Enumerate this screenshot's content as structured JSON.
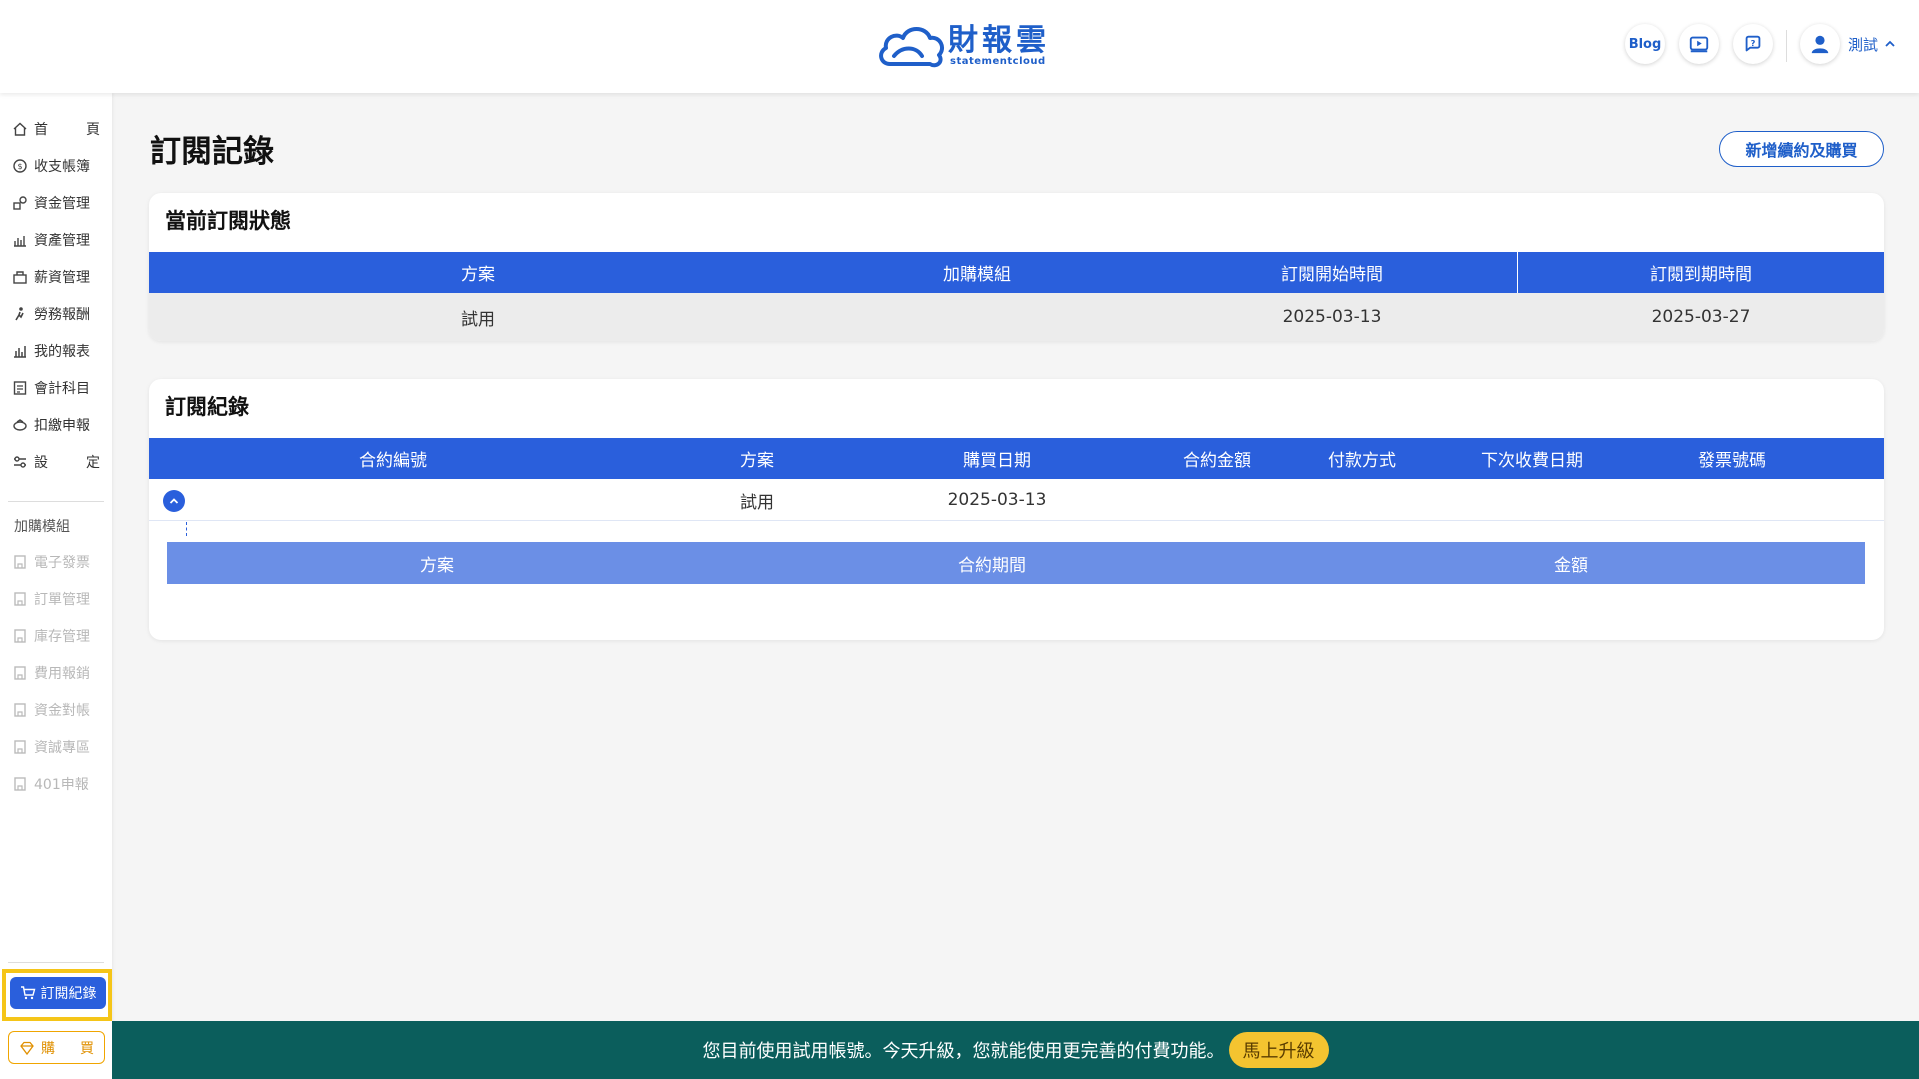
{
  "header": {
    "logo_text": "財報雲",
    "logo_sub": "statementcloud",
    "blog_label": "Blog",
    "user_name": "測試",
    "user_chevron": "^"
  },
  "sidebar": {
    "main_items": [
      {
        "label_a": "首",
        "label_b": "頁",
        "icon": "home-icon"
      },
      {
        "label": "收支帳簿",
        "icon": "ledger-icon"
      },
      {
        "label": "資金管理",
        "icon": "fund-icon"
      },
      {
        "label": "資產管理",
        "icon": "asset-icon"
      },
      {
        "label": "薪資管理",
        "icon": "salary-icon"
      },
      {
        "label": "勞務報酬",
        "icon": "labor-icon"
      },
      {
        "label": "我的報表",
        "icon": "report-icon"
      },
      {
        "label": "會計科目",
        "icon": "account-icon"
      },
      {
        "label": "扣繳申報",
        "icon": "withholding-icon"
      },
      {
        "label_a": "設",
        "label_b": "定",
        "icon": "settings-icon"
      }
    ],
    "addon_heading": "加購模組",
    "addon_items": [
      {
        "label": "電子發票"
      },
      {
        "label": "訂單管理"
      },
      {
        "label": "庫存管理"
      },
      {
        "label": "費用報銷"
      },
      {
        "label": "資金對帳"
      },
      {
        "label": "資誠專區"
      },
      {
        "label": "401申報"
      }
    ],
    "subscription_label": "訂閱紀錄",
    "buy_label_a": "購",
    "buy_label_b": "買"
  },
  "main": {
    "page_title": "訂閱記錄",
    "new_contract_button": "新增續約及購買",
    "current": {
      "title": "當前訂閱狀態",
      "columns": [
        "方案",
        "加購模組",
        "訂閱開始時間",
        "訂閱到期時間"
      ],
      "row": {
        "plan": "試用",
        "addons": "",
        "start": "2025-03-13",
        "end": "2025-03-27"
      }
    },
    "history": {
      "title": "訂閱紀錄",
      "columns": [
        "合約編號",
        "方案",
        "購買日期",
        "合約金額",
        "付款方式",
        "下次收費日期",
        "發票號碼"
      ],
      "row": {
        "contract_no": "",
        "plan": "試用",
        "purchase_date": "2025-03-13",
        "amount": "",
        "payment": "",
        "next_charge": "",
        "invoice": ""
      },
      "sub_columns": [
        "方案",
        "合約期間",
        "金額"
      ]
    }
  },
  "trial_bar": {
    "message": "您目前使用試用帳號。今天升級，您就能使用更完善的付費功能。",
    "upgrade_button": "馬上升級"
  },
  "colors": {
    "brand": "#1f5fc9",
    "table_header": "#2a5fdc",
    "sub_header": "#6b8fe6",
    "trial_bar": "#0b5e5c",
    "upgrade": "#f4c430",
    "highlight": "#f5c518"
  }
}
